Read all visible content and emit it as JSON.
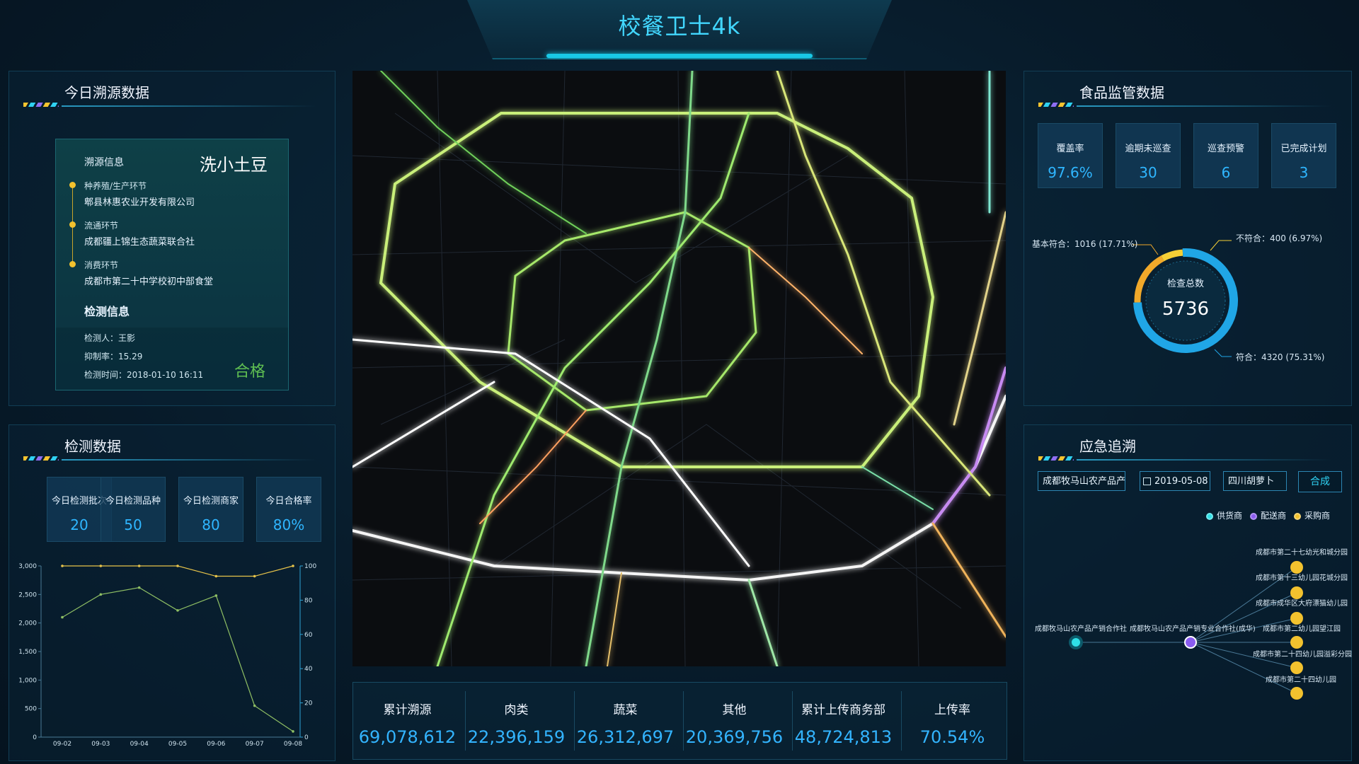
{
  "header": {
    "title": "校餐卫士4k"
  },
  "trace": {
    "title": "今日溯源数据",
    "info_label": "溯源信息",
    "product": "洗小土豆",
    "steps": [
      {
        "stage": "种养殖/生产环节",
        "name": "郫县林惠农业开发有限公司"
      },
      {
        "stage": "流通环节",
        "name": "成都疆上锦生态蔬菜联合社"
      },
      {
        "stage": "消费环节",
        "name": "成都市第二十中学校初中部食堂"
      }
    ],
    "test_title": "检测信息",
    "tester": "检测人：王影",
    "inhibition": "抑制率：15.29",
    "test_time": "检测时间：2018-01-10 16:11",
    "result": "合格"
  },
  "detection": {
    "title": "检测数据",
    "stats": [
      {
        "label": "今日检测批次",
        "value": "20"
      },
      {
        "label": "今日检测品种",
        "value": "50"
      },
      {
        "label": "今日检测商家",
        "value": "80"
      },
      {
        "label": "今日合格率",
        "value": "80%"
      }
    ]
  },
  "chart_data": {
    "type": "line",
    "x": [
      "09-02",
      "09-03",
      "09-04",
      "09-05",
      "09-06",
      "09-07",
      "09-08"
    ],
    "series": [
      {
        "name": "",
        "axis": "left",
        "values": [
          2100,
          2500,
          2620,
          2220,
          2480,
          550,
          100
        ]
      },
      {
        "name": "",
        "axis": "right",
        "values": [
          100,
          100,
          100,
          100,
          94,
          94,
          100
        ]
      }
    ],
    "ylim_left": [
      0,
      3000
    ],
    "yticks_left": [
      "0",
      "500",
      "1,000",
      "1,500",
      "2,000",
      "2,500",
      "3,000"
    ],
    "ylim_right": [
      0,
      100
    ],
    "yticks_right": [
      "0",
      "20",
      "40",
      "60",
      "80",
      "100"
    ],
    "colors": {
      "left": "#8fbf64",
      "right": "#e8c44a"
    },
    "grid": false
  },
  "totals": [
    {
      "label": "累计溯源",
      "value": "69,078,612"
    },
    {
      "label": "肉类",
      "value": "22,396,159"
    },
    {
      "label": "蔬菜",
      "value": "26,312,697"
    },
    {
      "label": "其他",
      "value": "20,369,756"
    },
    {
      "label": "累计上传商务部",
      "value": "48,724,813"
    },
    {
      "label": "上传率",
      "value": "70.54%"
    }
  ],
  "food": {
    "title": "食品监管数据",
    "stats": [
      {
        "label": "覆盖率",
        "value": "97.6%"
      },
      {
        "label": "逾期未巡查",
        "value": "30"
      },
      {
        "label": "巡查预警",
        "value": "6"
      },
      {
        "label": "已完成计划",
        "value": "3"
      }
    ],
    "donut": {
      "center_label": "检查总数",
      "center_value": "5736",
      "segments": [
        {
          "label": "符合：4320   (75.31%)",
          "value": 4320,
          "color": "#20a6e6"
        },
        {
          "label": "基本符合：1016   (17.71%)",
          "value": 1016,
          "color": "#f1a92a"
        },
        {
          "label": "不符合：400   (6.97%)",
          "value": 400,
          "color": "#f5cf36"
        }
      ]
    }
  },
  "emergency": {
    "title": "应急追溯",
    "supplier_input": "成都牧马山农产品产",
    "date_input": "2019-05-08",
    "product_input": "四川胡萝卜",
    "button": "合成",
    "legend": [
      {
        "label": "供货商",
        "color": "#2fe0e8"
      },
      {
        "label": "配送商",
        "color": "#8a5cf0"
      },
      {
        "label": "采购商",
        "color": "#f3c22e"
      }
    ],
    "supplier_node": "成都牧马山农产品产销合作社",
    "distributor_node": "成都牧马山农产品产销专业合作社(成华)",
    "buyers": [
      "成都市第二十七幼光和城分园",
      "成都市第十三幼儿园花城分园",
      "成都市成华区大府漂猫幼儿园",
      "成都市第二幼儿园望江园",
      "成都市第二十四幼儿园溢彩分园",
      "成都市第二十四幼儿园"
    ]
  }
}
